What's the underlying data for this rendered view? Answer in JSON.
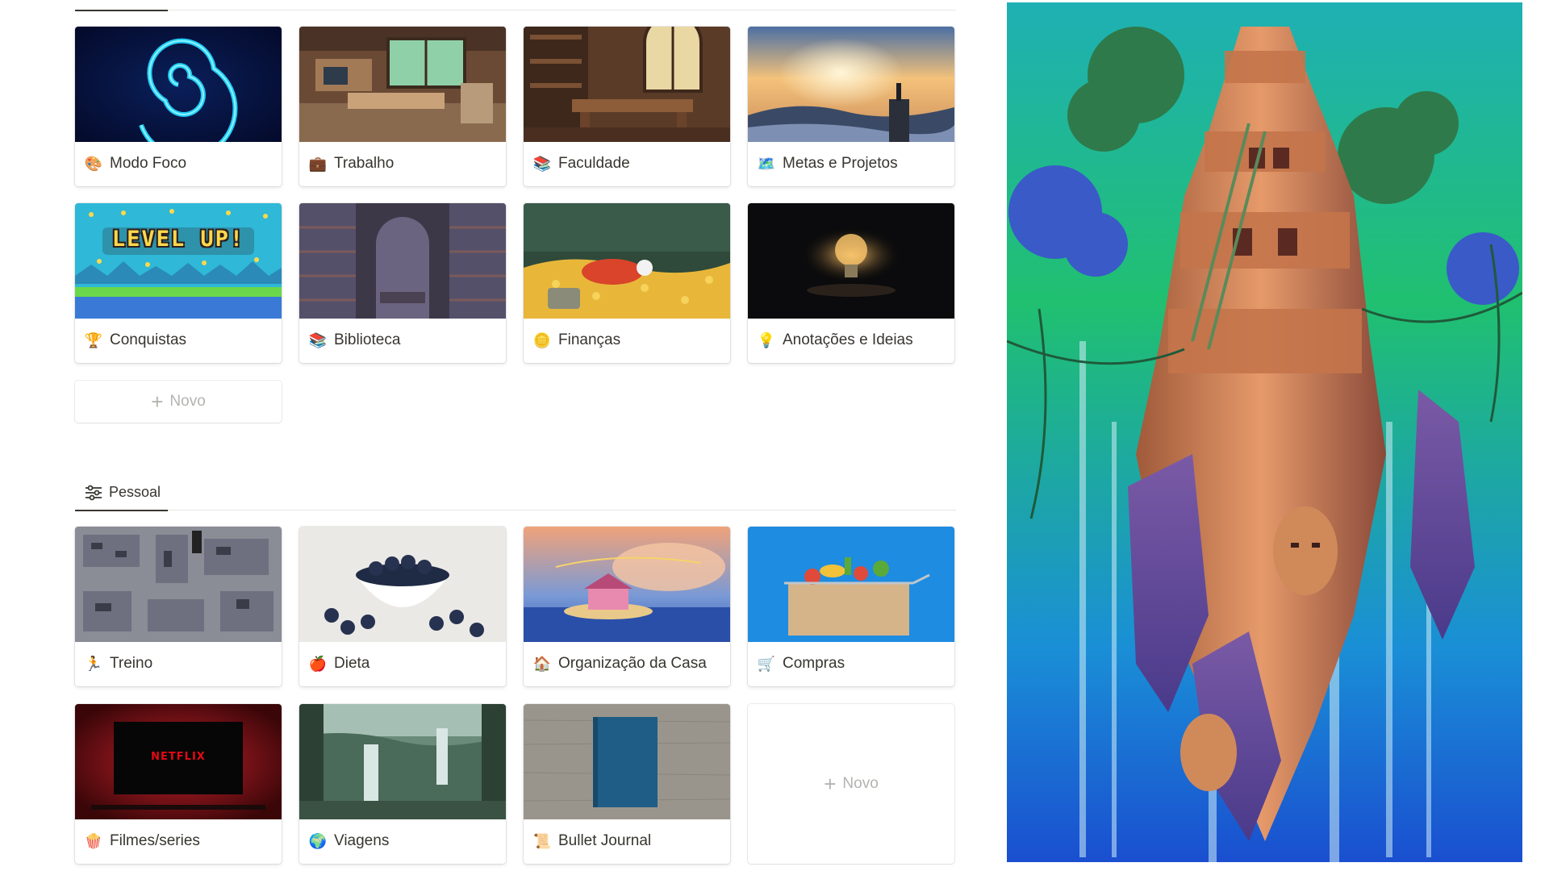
{
  "sections": {
    "pessoal_label": "Pessoal"
  },
  "cards_top": [
    {
      "title": "Modo Foco",
      "icon": "palette-icon"
    },
    {
      "title": "Trabalho",
      "icon": "briefcase-icon"
    },
    {
      "title": "Faculdade",
      "icon": "books-icon"
    },
    {
      "title": "Metas e Projetos",
      "icon": "map-icon"
    },
    {
      "title": "Conquistas",
      "icon": "trophy-icon"
    },
    {
      "title": "Biblioteca",
      "icon": "book-stack-icon"
    },
    {
      "title": "Finanças",
      "icon": "coin-icon"
    },
    {
      "title": "Anotações e Ideias",
      "icon": "lightbulb-icon"
    }
  ],
  "cards_pessoal": [
    {
      "title": "Treino",
      "icon": "runner-icon"
    },
    {
      "title": "Dieta",
      "icon": "apple-icon"
    },
    {
      "title": "Organização da Casa",
      "icon": "house-icon"
    },
    {
      "title": "Compras",
      "icon": "cart-icon"
    },
    {
      "title": "Filmes/series",
      "icon": "popcorn-icon"
    },
    {
      "title": "Viagens",
      "icon": "globe-icon"
    },
    {
      "title": "Bullet Journal",
      "icon": "scroll-icon"
    }
  ],
  "new_label": "Novo",
  "cover_texts": {
    "level_up": "LEVEL UP!",
    "netflix": "NETFLIX"
  },
  "colors": {
    "text": "#37352f",
    "muted": "#b4b3b0",
    "divider": "#e6e6e4"
  }
}
